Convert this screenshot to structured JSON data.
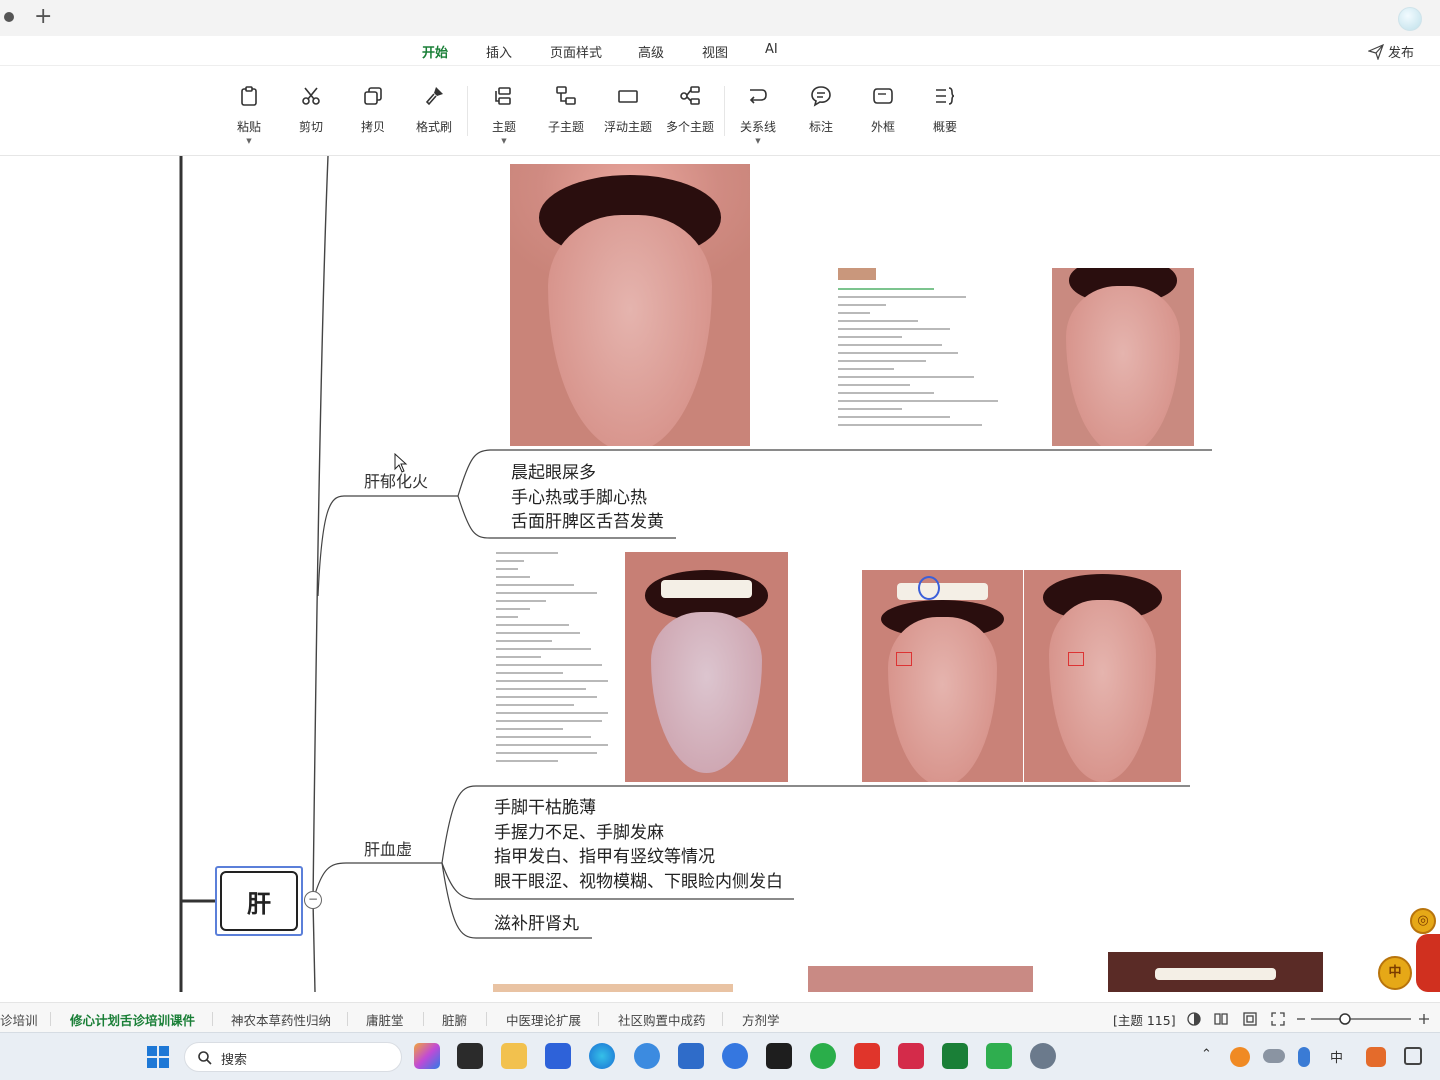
{
  "menu": {
    "tabs": [
      "开始",
      "插入",
      "页面样式",
      "高级",
      "视图",
      "AI"
    ],
    "active": "开始",
    "publish_label": "发布"
  },
  "toolbar": {
    "paste": "粘贴",
    "cut": "剪切",
    "copy": "拷贝",
    "format_painter": "格式刷",
    "topic": "主题",
    "subtopic": "子主题",
    "floating_topic": "浮动主题",
    "multi_topic": "多个主题",
    "relationship": "关系线",
    "callout": "标注",
    "boundary": "外框",
    "summary": "概要"
  },
  "mindmap": {
    "root": "肝",
    "collapse_symbol": "−",
    "branch1": {
      "label": "肝郁化火",
      "items": [
        "晨起眼屎多",
        "手心热或手脚心热",
        "舌面肝脾区舌苔发黄"
      ]
    },
    "branch2": {
      "label": "肝血虚",
      "items": [
        "手脚干枯脆薄",
        "手握力不足、手脚发麻",
        "指甲发白、指甲有竖纹等情况",
        "眼干眼涩、视物模糊、下眼睑内侧发白"
      ],
      "remedy": "滋补肝肾丸"
    }
  },
  "bottom_tabs": {
    "items": [
      "诊培训",
      "修心计划舌诊培训课件",
      "神农本草药性归纳",
      "庸脏堂",
      "脏腑",
      "中医理论扩展",
      "社区购置中成药",
      "方剂学"
    ],
    "active": "修心计划舌诊培训课件",
    "status": "[主题 115]"
  },
  "taskbar": {
    "search_label": "搜索",
    "ime_label": "中"
  },
  "colors": {
    "accent": "#1a7f37",
    "root_selection": "#5b7fd9"
  }
}
